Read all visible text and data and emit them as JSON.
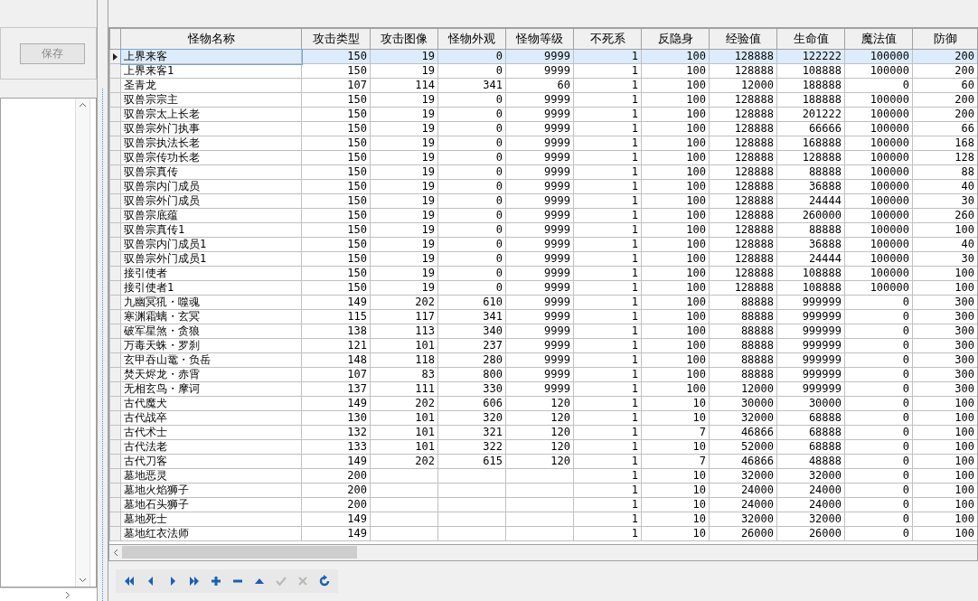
{
  "left_panel": {
    "save_button": {
      "label": "保存",
      "disabled": true
    }
  },
  "table": {
    "columns": [
      "怪物名称",
      "攻击类型",
      "攻击图像",
      "怪物外观",
      "怪物等级",
      "不死系",
      "反隐身",
      "经验值",
      "生命值",
      "魔法值",
      "防御"
    ],
    "rows": [
      {
        "selected": true,
        "cells": [
          "上界来客",
          "150",
          "19",
          "0",
          "9999",
          "1",
          "100",
          "128888",
          "122222",
          "100000",
          "200"
        ]
      },
      {
        "selected": false,
        "cells": [
          "上界来客1",
          "150",
          "19",
          "0",
          "9999",
          "1",
          "100",
          "128888",
          "108888",
          "100000",
          "200"
        ]
      },
      {
        "selected": false,
        "cells": [
          "圣青龙",
          "107",
          "114",
          "341",
          "60",
          "1",
          "100",
          "12000",
          "188888",
          "0",
          "60"
        ]
      },
      {
        "selected": false,
        "cells": [
          "驭兽宗宗主",
          "150",
          "19",
          "0",
          "9999",
          "1",
          "100",
          "128888",
          "188888",
          "100000",
          "200"
        ]
      },
      {
        "selected": false,
        "cells": [
          "驭兽宗太上长老",
          "150",
          "19",
          "0",
          "9999",
          "1",
          "100",
          "128888",
          "201222",
          "100000",
          "200"
        ]
      },
      {
        "selected": false,
        "cells": [
          "驭兽宗外门执事",
          "150",
          "19",
          "0",
          "9999",
          "1",
          "100",
          "128888",
          "66666",
          "100000",
          "66"
        ]
      },
      {
        "selected": false,
        "cells": [
          "驭兽宗执法长老",
          "150",
          "19",
          "0",
          "9999",
          "1",
          "100",
          "128888",
          "168888",
          "100000",
          "168"
        ]
      },
      {
        "selected": false,
        "cells": [
          "驭兽宗传功长老",
          "150",
          "19",
          "0",
          "9999",
          "1",
          "100",
          "128888",
          "128888",
          "100000",
          "128"
        ]
      },
      {
        "selected": false,
        "cells": [
          "驭兽宗真传",
          "150",
          "19",
          "0",
          "9999",
          "1",
          "100",
          "128888",
          "88888",
          "100000",
          "88"
        ]
      },
      {
        "selected": false,
        "cells": [
          "驭兽宗内门成员",
          "150",
          "19",
          "0",
          "9999",
          "1",
          "100",
          "128888",
          "36888",
          "100000",
          "40"
        ]
      },
      {
        "selected": false,
        "cells": [
          "驭兽宗外门成员",
          "150",
          "19",
          "0",
          "9999",
          "1",
          "100",
          "128888",
          "24444",
          "100000",
          "30"
        ]
      },
      {
        "selected": false,
        "cells": [
          "驭兽宗底蕴",
          "150",
          "19",
          "0",
          "9999",
          "1",
          "100",
          "128888",
          "260000",
          "100000",
          "260"
        ]
      },
      {
        "selected": false,
        "cells": [
          "驭兽宗真传1",
          "150",
          "19",
          "0",
          "9999",
          "1",
          "100",
          "128888",
          "88888",
          "100000",
          "100"
        ]
      },
      {
        "selected": false,
        "cells": [
          "驭兽宗内门成员1",
          "150",
          "19",
          "0",
          "9999",
          "1",
          "100",
          "128888",
          "36888",
          "100000",
          "40"
        ]
      },
      {
        "selected": false,
        "cells": [
          "驭兽宗外门成员1",
          "150",
          "19",
          "0",
          "9999",
          "1",
          "100",
          "128888",
          "24444",
          "100000",
          "30"
        ]
      },
      {
        "selected": false,
        "cells": [
          "接引使者",
          "150",
          "19",
          "0",
          "9999",
          "1",
          "100",
          "128888",
          "108888",
          "100000",
          "100"
        ]
      },
      {
        "selected": false,
        "cells": [
          "接引使者1",
          "150",
          "19",
          "0",
          "9999",
          "1",
          "100",
          "128888",
          "108888",
          "100000",
          "100"
        ]
      },
      {
        "selected": false,
        "cells": [
          "九幽冥犼・噬魂",
          "149",
          "202",
          "610",
          "9999",
          "1",
          "100",
          "88888",
          "999999",
          "0",
          "300"
        ]
      },
      {
        "selected": false,
        "cells": [
          "寒渊霜螭・玄冥",
          "115",
          "117",
          "341",
          "9999",
          "1",
          "100",
          "88888",
          "999999",
          "0",
          "300"
        ]
      },
      {
        "selected": false,
        "cells": [
          "破军星煞・贪狼",
          "138",
          "113",
          "340",
          "9999",
          "1",
          "100",
          "88888",
          "999999",
          "0",
          "300"
        ]
      },
      {
        "selected": false,
        "cells": [
          "万毒天蛛・罗刹",
          "121",
          "101",
          "237",
          "9999",
          "1",
          "100",
          "88888",
          "999999",
          "0",
          "300"
        ]
      },
      {
        "selected": false,
        "cells": [
          "玄甲吞山鼋・负岳",
          "148",
          "118",
          "280",
          "9999",
          "1",
          "100",
          "88888",
          "999999",
          "0",
          "300"
        ]
      },
      {
        "selected": false,
        "cells": [
          "焚天烬龙・赤霄",
          "107",
          "83",
          "800",
          "9999",
          "1",
          "100",
          "88888",
          "999999",
          "0",
          "300"
        ]
      },
      {
        "selected": false,
        "cells": [
          "无相玄鸟・摩诃",
          "137",
          "111",
          "330",
          "9999",
          "1",
          "100",
          "12000",
          "999999",
          "0",
          "300"
        ]
      },
      {
        "selected": false,
        "cells": [
          "古代魔犬",
          "149",
          "202",
          "606",
          "120",
          "1",
          "10",
          "30000",
          "30000",
          "0",
          "100"
        ]
      },
      {
        "selected": false,
        "cells": [
          "古代战卒",
          "130",
          "101",
          "320",
          "120",
          "1",
          "10",
          "32000",
          "68888",
          "0",
          "100"
        ]
      },
      {
        "selected": false,
        "cells": [
          "古代术士",
          "132",
          "101",
          "321",
          "120",
          "1",
          "7",
          "46866",
          "68888",
          "0",
          "100"
        ]
      },
      {
        "selected": false,
        "cells": [
          "古代法老",
          "133",
          "101",
          "322",
          "120",
          "1",
          "10",
          "52000",
          "68888",
          "0",
          "100"
        ]
      },
      {
        "selected": false,
        "cells": [
          "古代刀客",
          "149",
          "202",
          "615",
          "120",
          "1",
          "7",
          "46866",
          "48888",
          "0",
          "100"
        ]
      },
      {
        "selected": false,
        "cells": [
          "墓地恶灵",
          "200",
          null,
          null,
          null,
          "1",
          "10",
          "32000",
          "32000",
          "0",
          "100"
        ]
      },
      {
        "selected": false,
        "cells": [
          "墓地火焰狮子",
          "200",
          null,
          null,
          null,
          "1",
          "10",
          "24000",
          "24000",
          "0",
          "100"
        ]
      },
      {
        "selected": false,
        "cells": [
          "墓地石头狮子",
          "200",
          null,
          null,
          null,
          "1",
          "10",
          "24000",
          "24000",
          "0",
          "100"
        ]
      },
      {
        "selected": false,
        "cells": [
          "墓地死士",
          "149",
          null,
          null,
          null,
          "1",
          "10",
          "32000",
          "32000",
          "0",
          "100"
        ]
      },
      {
        "selected": false,
        "cells": [
          "墓地红衣法师",
          "149",
          null,
          null,
          null,
          "1",
          "10",
          "26000",
          "26000",
          "0",
          "100"
        ]
      }
    ]
  },
  "navigator": [
    {
      "kind": "first",
      "disabled": false
    },
    {
      "kind": "prior",
      "disabled": false
    },
    {
      "kind": "next",
      "disabled": false
    },
    {
      "kind": "last",
      "disabled": false
    },
    {
      "kind": "insert",
      "disabled": false
    },
    {
      "kind": "delete",
      "disabled": false
    },
    {
      "kind": "edit",
      "disabled": false
    },
    {
      "kind": "post",
      "disabled": true
    },
    {
      "kind": "cancel",
      "disabled": true
    },
    {
      "kind": "refresh",
      "disabled": false
    }
  ]
}
